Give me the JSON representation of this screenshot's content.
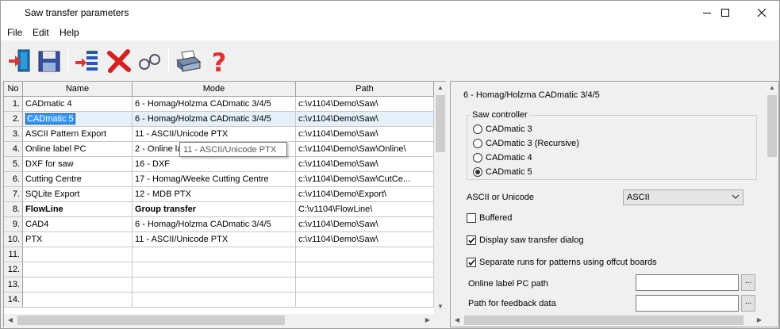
{
  "window": {
    "title": "Saw transfer parameters"
  },
  "menu": [
    "File",
    "Edit",
    "Help"
  ],
  "grid": {
    "columns": {
      "no": "No",
      "name": "Name",
      "mode": "Mode",
      "path": "Path"
    },
    "rows": [
      {
        "no": "1.",
        "name": "CADmatic 4",
        "mode": "6 - Homag/Holzma CADmatic 3/4/5",
        "path": "c:\\v1104\\Demo\\Saw\\"
      },
      {
        "no": "2.",
        "name": "CADmatic 5",
        "mode": "6 - Homag/Holzma CADmatic 3/4/5",
        "path": "c:\\v1104\\Demo\\Saw\\"
      },
      {
        "no": "3.",
        "name": "ASCII Pattern Export",
        "mode": "11 - ASCII/Unicode PTX",
        "path": "c:\\v1104\\Demo\\Saw\\"
      },
      {
        "no": "4.",
        "name": "Online label PC",
        "mode": "2 - Online la",
        "path": "c:\\v1104\\Demo\\Saw\\Online\\"
      },
      {
        "no": "5.",
        "name": "DXF for saw",
        "mode": "16 - DXF",
        "path": "c:\\v1104\\Demo\\Saw\\"
      },
      {
        "no": "6.",
        "name": "Cutting Centre",
        "mode": "17 - Homag/Weeke Cutting Centre",
        "path": "c:\\v1104\\Demo\\Saw\\CutCe..."
      },
      {
        "no": "7.",
        "name": "SQLite Export",
        "mode": "12 - MDB PTX",
        "path": "c:\\v1104\\Demo\\Export\\"
      },
      {
        "no": "8.",
        "name": "FlowLine",
        "mode": "Group transfer",
        "path": "C:\\v1104\\FlowLine\\"
      },
      {
        "no": "9.",
        "name": "CAD4",
        "mode": "6 - Homag/Holzma CADmatic 3/4/5",
        "path": "c:\\v1104\\Demo\\Saw\\"
      },
      {
        "no": "10.",
        "name": "PTX",
        "mode": "11 - ASCII/Unicode PTX",
        "path": "c:\\v1104\\Demo\\Saw\\"
      },
      {
        "no": "11.",
        "name": "",
        "mode": "",
        "path": ""
      },
      {
        "no": "12.",
        "name": "",
        "mode": "",
        "path": ""
      },
      {
        "no": "13.",
        "name": "",
        "mode": "",
        "path": ""
      },
      {
        "no": "14.",
        "name": "",
        "mode": "",
        "path": ""
      }
    ],
    "selected_row": "2.",
    "tooltip": "11 - ASCII/Unicode PTX"
  },
  "panel": {
    "title": "6 - Homag/Holzma CADmatic 3/4/5",
    "saw_controller": {
      "label": "Saw controller",
      "options": [
        "CADmatic 3",
        "CADmatic 3 (Recursive)",
        "CADmatic 4",
        "CADmatic 5"
      ],
      "selected": "CADmatic 5"
    },
    "ascii_label": "ASCII or Unicode",
    "ascii_value": "ASCII",
    "buffered": {
      "label": "Buffered",
      "checked": false
    },
    "display_dialog": {
      "label": "Display saw transfer dialog",
      "checked": true
    },
    "separate_runs": {
      "label": "Separate runs for patterns using offcut boards",
      "checked": true
    },
    "online_path": {
      "label": "Online label PC path",
      "value": "",
      "button": "..."
    },
    "feedback_path": {
      "label": "Path for feedback data",
      "value": "",
      "button": "..."
    }
  },
  "colors": {
    "selection": "#3399ff",
    "row_highlight": "#e5f0fb"
  }
}
